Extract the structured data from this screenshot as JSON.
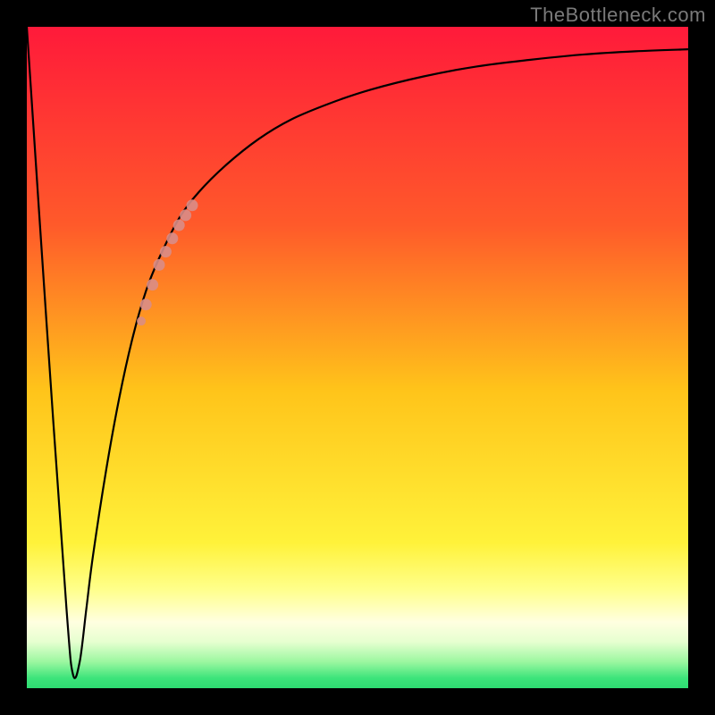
{
  "attribution": "TheBottleneck.com",
  "chart_data": {
    "type": "line",
    "title": "",
    "xlabel": "",
    "ylabel": "",
    "xlim": [
      0,
      100
    ],
    "ylim": [
      0,
      100
    ],
    "gradient_stops": [
      {
        "offset": 0,
        "color": "#ff1a3a"
      },
      {
        "offset": 0.3,
        "color": "#ff5a2a"
      },
      {
        "offset": 0.55,
        "color": "#ffc41a"
      },
      {
        "offset": 0.78,
        "color": "#fff23a"
      },
      {
        "offset": 0.85,
        "color": "#ffff8a"
      },
      {
        "offset": 0.9,
        "color": "#ffffe0"
      },
      {
        "offset": 0.93,
        "color": "#e6ffd0"
      },
      {
        "offset": 0.96,
        "color": "#9cf7a0"
      },
      {
        "offset": 0.985,
        "color": "#3ce47a"
      },
      {
        "offset": 1.0,
        "color": "#2edc72"
      }
    ],
    "series": [
      {
        "name": "bottleneck-curve",
        "x": [
          0,
          3,
          6,
          7,
          8,
          9,
          10,
          12,
          14,
          16,
          18,
          20,
          23,
          26,
          30,
          35,
          40,
          46,
          52,
          60,
          68,
          76,
          84,
          92,
          100
        ],
        "y": [
          100,
          55,
          12,
          2,
          4,
          12,
          20,
          33,
          44,
          53,
          60,
          65,
          71,
          75,
          79,
          83,
          86,
          88.5,
          90.5,
          92.5,
          94,
          95,
          95.8,
          96.3,
          96.6
        ]
      }
    ],
    "highlight_segment": {
      "name": "marker-band",
      "color": "#d98d87",
      "x": [
        18,
        19,
        20,
        21,
        22,
        23,
        24,
        25
      ],
      "y": [
        58,
        61,
        64,
        66,
        68,
        70,
        71.5,
        73
      ]
    }
  }
}
